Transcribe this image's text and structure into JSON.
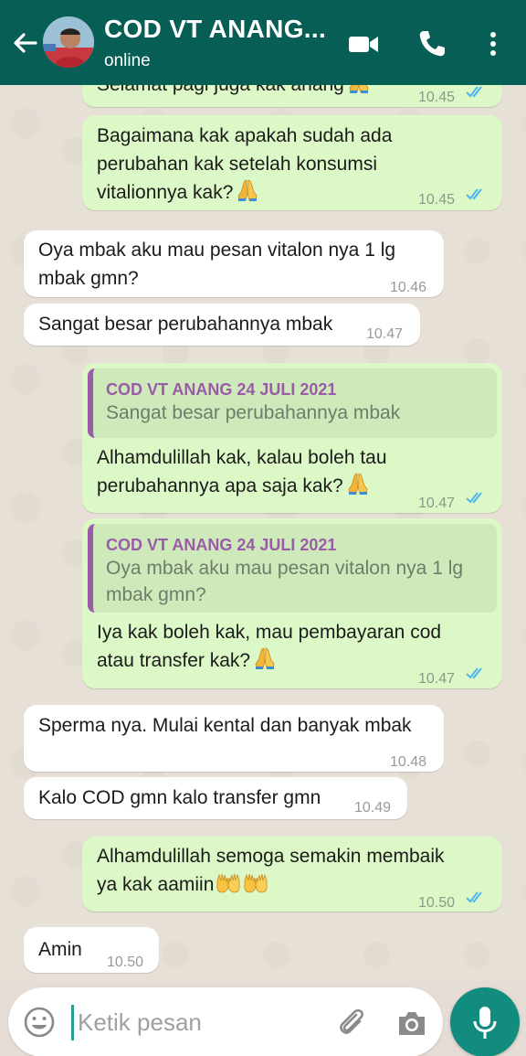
{
  "header": {
    "contact_name": "COD VT ANANG...",
    "status": "online"
  },
  "icons": {
    "back": "arrow-left-icon",
    "video": "video-call-icon",
    "call": "phone-icon",
    "menu": "more-vertical-icon",
    "emoji": "emoji-icon",
    "attach": "paperclip-icon",
    "camera": "camera-icon",
    "mic": "mic-icon"
  },
  "colors": {
    "header": "#075e54",
    "outgoing_bubble": "#dcf8c6",
    "incoming_bubble": "#ffffff",
    "read_ticks": "#4fb6ec",
    "quote_accent": "#9a5ba8",
    "mic_button": "#128c7e"
  },
  "messages": [
    {
      "direction": "out",
      "lines": [
        "Selamat pagi juga kak anang"
      ],
      "emoji": "folded-hands",
      "time": "10.45",
      "status": "read"
    },
    {
      "direction": "out",
      "lines": [
        "Bagaimana kak apakah sudah ada",
        "perubahan kak setelah konsumsi",
        "vitalionnya kak?"
      ],
      "emoji": "folded-hands",
      "time": "10.45",
      "status": "read"
    },
    {
      "direction": "in",
      "lines": [
        "Oya mbak aku mau pesan vitalon nya 1 lg",
        "mbak gmn?"
      ],
      "time": "10.46"
    },
    {
      "direction": "in",
      "lines": [
        "Sangat besar perubahannya mbak"
      ],
      "time": "10.47"
    },
    {
      "direction": "out",
      "quote": {
        "author": "COD VT ANANG 24 JULI 2021",
        "lines": [
          "Sangat besar perubahannya mbak"
        ]
      },
      "lines": [
        "Alhamdulillah kak, kalau boleh tau",
        "perubahannya apa saja kak?"
      ],
      "emoji": "folded-hands",
      "time": "10.47",
      "status": "read"
    },
    {
      "direction": "out",
      "quote": {
        "author": "COD VT ANANG 24 JULI 2021",
        "lines": [
          "Oya mbak aku mau pesan vitalon nya 1 lg",
          "mbak gmn?"
        ]
      },
      "lines": [
        "Iya kak boleh kak, mau pembayaran cod",
        "atau transfer kak?"
      ],
      "emoji": "folded-hands",
      "time": "10.47",
      "status": "read"
    },
    {
      "direction": "in",
      "lines": [
        "Sperma nya. Mulai kental dan banyak mbak"
      ],
      "time": "10.48"
    },
    {
      "direction": "in",
      "lines": [
        "Kalo COD gmn kalo transfer gmn"
      ],
      "time": "10.49"
    },
    {
      "direction": "out",
      "lines": [
        "Alhamdulillah semoga semakin membaik",
        "ya kak aamiin"
      ],
      "emoji": "palms-up-together x2",
      "time": "10.50",
      "status": "read"
    },
    {
      "direction": "in",
      "lines": [
        "Amin"
      ],
      "time": "10.50"
    }
  ],
  "composer": {
    "placeholder": "Ketik pesan"
  }
}
